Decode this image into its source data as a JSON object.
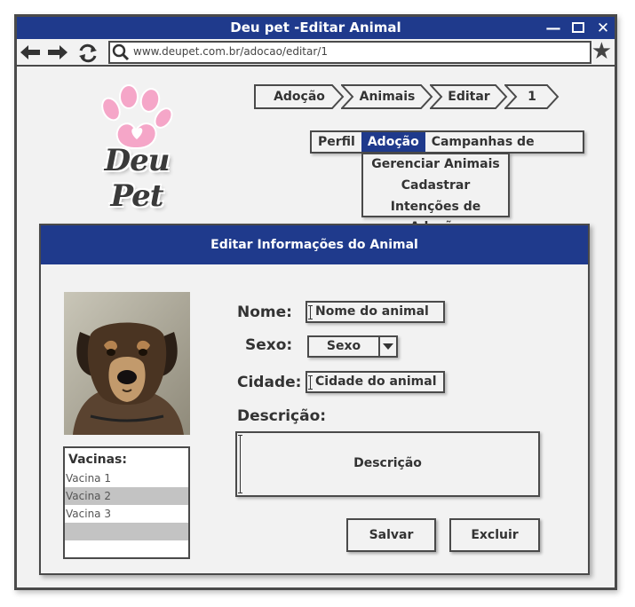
{
  "window": {
    "title": "Deu pet -Editar Animal",
    "controls": [
      "minimize-icon",
      "maximize-icon",
      "close-icon"
    ]
  },
  "browser": {
    "url": "www.deupet.com.br/adocao/editar/1",
    "icons": [
      "back-arrow-icon",
      "forward-arrow-icon",
      "refresh-icon",
      "search-icon",
      "bookmark-star-icon"
    ]
  },
  "logo": {
    "text": "Deu Pet"
  },
  "breadcrumb": [
    "Adoção",
    "Animais",
    "Editar",
    "1"
  ],
  "menu": {
    "items": [
      "Perfil",
      "Adoção",
      "Campanhas de Saúde"
    ],
    "active": "Adoção",
    "dropdown": [
      "Gerenciar Animais",
      "Cadastrar",
      "Intenções de Adoção"
    ]
  },
  "panel": {
    "title": "Editar Informações do Animal"
  },
  "form": {
    "nome_label": "Nome:",
    "nome_placeholder": "Nome do animal",
    "sexo_label": "Sexo:",
    "sexo_value": "Sexo",
    "cidade_label": "Cidade:",
    "cidade_placeholder": "Cidade do animal",
    "descricao_label": "Descrição:",
    "descricao_placeholder": "Descrição"
  },
  "vacinas": {
    "title": "Vacinas:",
    "items": [
      "Vacina 1",
      "Vacina 2",
      "Vacina 3",
      ""
    ]
  },
  "buttons": {
    "save": "Salvar",
    "delete": "Excluir"
  },
  "colors": {
    "accent": "#1f3a8c",
    "border": "#4a4a4a",
    "background": "#f2f2f2"
  }
}
